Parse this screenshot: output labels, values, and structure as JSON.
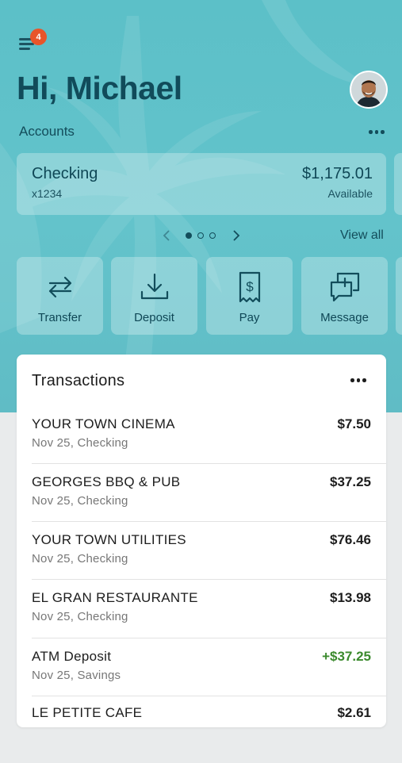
{
  "header": {
    "notification_count": "4",
    "greeting": "Hi, Michael"
  },
  "accounts": {
    "label": "Accounts",
    "card": {
      "name": "Checking",
      "number": "x1234",
      "balance": "$1,175.01",
      "balance_label": "Available"
    },
    "pager": {
      "current_page": 1,
      "total_pages": 3
    },
    "view_all": "View all"
  },
  "actions": [
    {
      "label": "Transfer",
      "icon": "transfer-icon"
    },
    {
      "label": "Deposit",
      "icon": "deposit-icon"
    },
    {
      "label": "Pay",
      "icon": "pay-icon"
    },
    {
      "label": "Message",
      "icon": "message-icon"
    }
  ],
  "transactions": {
    "title": "Transactions",
    "items": [
      {
        "merchant": "YOUR TOWN CINEMA",
        "amount": "$7.50",
        "detail": "Nov 25, Checking",
        "positive": false
      },
      {
        "merchant": "GEORGES BBQ & PUB",
        "amount": "$37.25",
        "detail": "Nov 25, Checking",
        "positive": false
      },
      {
        "merchant": "YOUR TOWN UTILITIES",
        "amount": "$76.46",
        "detail": "Nov 25, Checking",
        "positive": false
      },
      {
        "merchant": "EL GRAN RESTAURANTE",
        "amount": "$13.98",
        "detail": "Nov 25, Checking",
        "positive": false
      },
      {
        "merchant": "ATM Deposit",
        "amount": "+$37.25",
        "detail": "Nov 25, Savings",
        "positive": true
      },
      {
        "merchant": "LE PETITE CAFE",
        "amount": "$2.61",
        "detail": "",
        "positive": false
      }
    ]
  },
  "colors": {
    "hero": "#5cc0c8",
    "heading": "#114b5a",
    "badge": "#e8552a",
    "positive_amount": "#3b8a2d"
  }
}
